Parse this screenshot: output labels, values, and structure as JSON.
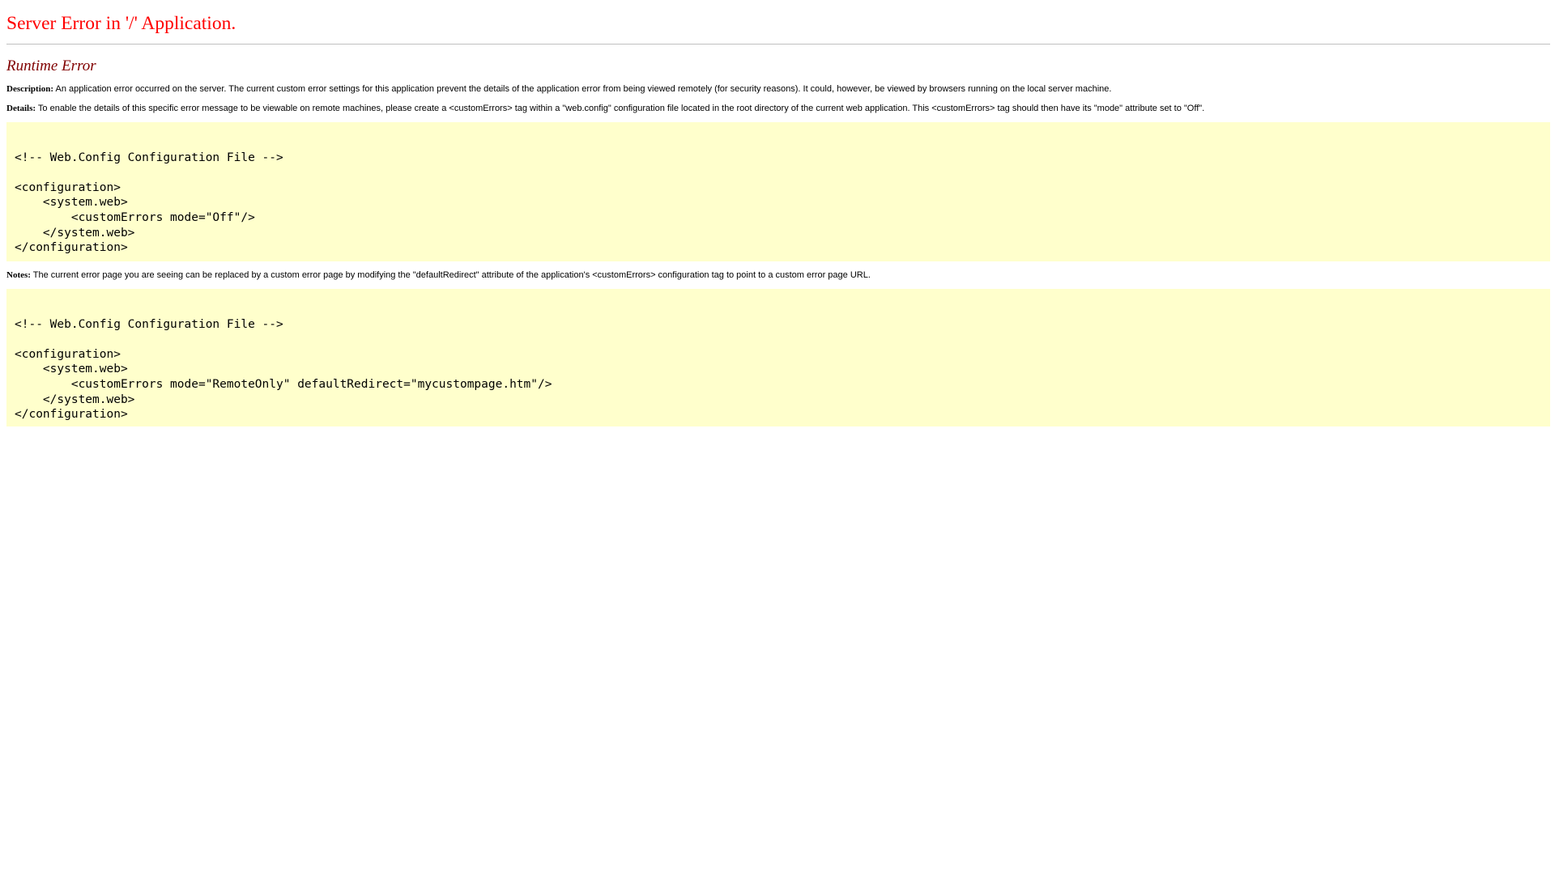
{
  "page": {
    "title": "Server Error in '/' Application.",
    "subtitle": "Runtime Error"
  },
  "description": {
    "label": "Description:",
    "text": " An application error occurred on the server. The current custom error settings for this application prevent the details of the application error from being viewed remotely (for security reasons). It could, however, be viewed by browsers running on the local server machine."
  },
  "details": {
    "label": "Details:",
    "text": " To enable the details of this specific error message to be viewable on remote machines, please create a <customErrors> tag within a \"web.config\" configuration file located in the root directory of the current web application. This <customErrors> tag should then have its \"mode\" attribute set to \"Off\"."
  },
  "code_block_1": "\n<!-- Web.Config Configuration File -->\n\n<configuration>\n    <system.web>\n        <customErrors mode=\"Off\"/>\n    </system.web>\n</configuration>",
  "notes": {
    "label": "Notes:",
    "text": " The current error page you are seeing can be replaced by a custom error page by modifying the \"defaultRedirect\" attribute of the application's <customErrors> configuration tag to point to a custom error page URL."
  },
  "code_block_2": "\n<!-- Web.Config Configuration File -->\n\n<configuration>\n    <system.web>\n        <customErrors mode=\"RemoteOnly\" defaultRedirect=\"mycustompage.htm\"/>\n    </system.web>\n</configuration>",
  "colors": {
    "title": "#ff0000",
    "subtitle": "#800000",
    "code_background": "#ffffcc",
    "rule": "#c0c0c0"
  }
}
